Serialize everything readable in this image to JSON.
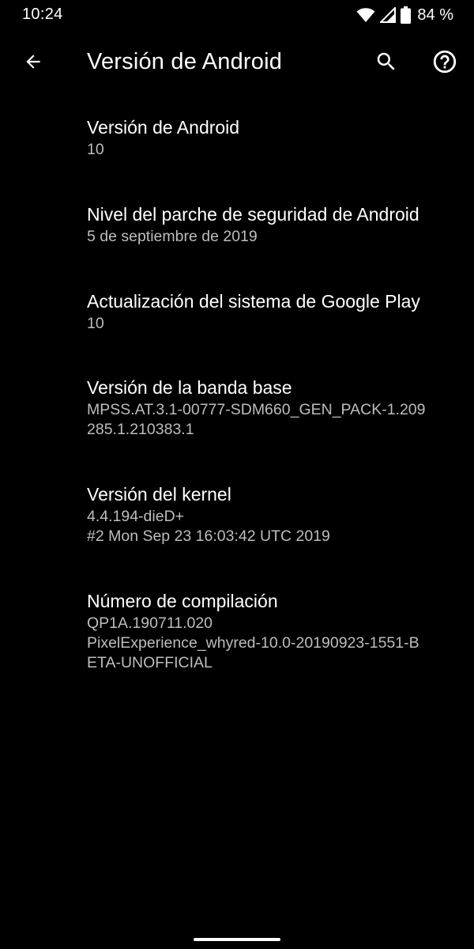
{
  "status_bar": {
    "time": "10:24",
    "battery_text": "84 %",
    "icons": [
      "wifi-icon",
      "signal-icon",
      "battery-icon"
    ]
  },
  "app_bar": {
    "title": "Versión de Android",
    "icons": [
      "back-arrow-icon",
      "search-icon",
      "help-icon"
    ]
  },
  "items": [
    {
      "title": "Versión de Android",
      "summary_lines": [
        "10"
      ]
    },
    {
      "title": "Nivel del parche de seguridad de Android",
      "summary_lines": [
        "5 de septiembre de 2019"
      ]
    },
    {
      "title": "Actualización del sistema de Google Play",
      "summary_lines": [
        "10"
      ]
    },
    {
      "title": "Versión de la banda base",
      "summary_lines": [
        "MPSS.AT.3.1-00777-SDM660_GEN_PACK-1.209",
        "285.1.210383.1"
      ]
    },
    {
      "title": "Versión del kernel",
      "summary_lines": [
        "4.4.194-dieD+",
        "#2 Mon Sep 23 16:03:42 UTC 2019"
      ]
    },
    {
      "title": "Número de compilación",
      "summary_lines": [
        "QP1A.190711.020",
        "PixelExperience_whyred-10.0-20190923-1551-B",
        "ETA-UNOFFICIAL"
      ]
    }
  ],
  "colors": {
    "background": "#000000",
    "primary_text": "#ffffff",
    "secondary_text": "#bdbdbd"
  }
}
